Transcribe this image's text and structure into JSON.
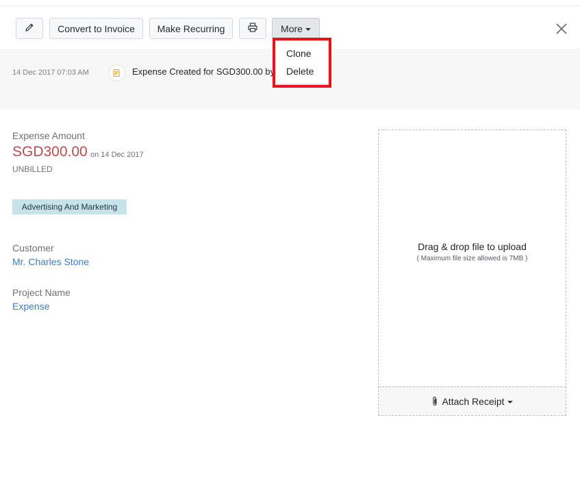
{
  "toolbar": {
    "convert_label": "Convert to Invoice",
    "recurring_label": "Make Recurring",
    "more_label": "More"
  },
  "more_menu": {
    "items": [
      "Clone",
      "Delete"
    ]
  },
  "history": {
    "timestamp": "14 Dec 2017 07:03 AM",
    "message": "Expense Created for SGD300.00 by"
  },
  "expense": {
    "amount_label": "Expense Amount",
    "amount": "SGD300.00",
    "date_text": "on 14 Dec 2017",
    "status": "UNBILLED",
    "category": "Advertising And Marketing",
    "customer_label": "Customer",
    "customer": "Mr. Charles Stone",
    "project_label": "Project Name",
    "project": "Expense"
  },
  "upload": {
    "title": "Drag & drop file to upload",
    "subtitle": "( Maximum file size allowed is 7MB )",
    "attach_label": "Attach Receipt"
  },
  "icons": {
    "edit": "pencil-icon",
    "print": "printer-icon",
    "close": "close-icon",
    "history": "note-icon",
    "attach": "paperclip-icon"
  },
  "colors": {
    "amount": "#b84c4c",
    "link": "#3f7cc4",
    "tag_bg": "#c7e3ea",
    "highlight": "#e8131b"
  }
}
